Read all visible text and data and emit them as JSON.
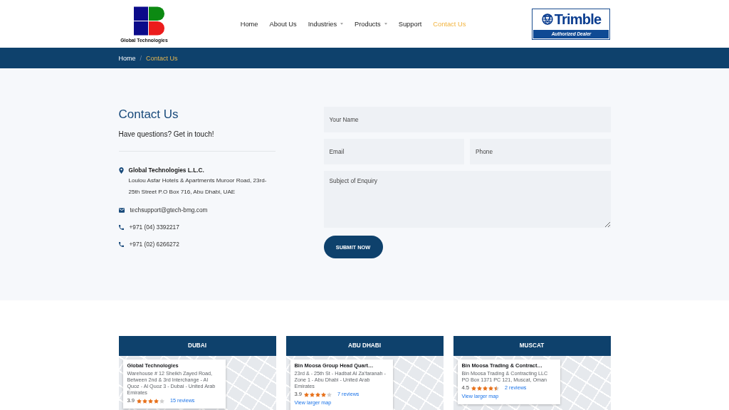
{
  "header": {
    "logo": {
      "caption": "Global Technologies"
    },
    "nav": [
      {
        "label": "Home",
        "selected": false,
        "has_dropdown": false
      },
      {
        "label": "About Us",
        "selected": false,
        "has_dropdown": false
      },
      {
        "label": "Industries",
        "selected": false,
        "has_dropdown": true
      },
      {
        "label": "Products",
        "selected": false,
        "has_dropdown": true
      },
      {
        "label": "Support",
        "selected": false,
        "has_dropdown": false
      },
      {
        "label": "Contact Us",
        "selected": true,
        "has_dropdown": false
      }
    ],
    "partner_badge": {
      "brand": "Trimble",
      "tagline": "Authorized Dealer"
    }
  },
  "breadcrumb": {
    "separator": "/",
    "items": [
      {
        "label": "Home",
        "current": false
      },
      {
        "label": "Contact Us",
        "current": true
      }
    ]
  },
  "contact": {
    "title": "Contact Us",
    "subtitle": "Have questions? Get in touch!",
    "details": [
      {
        "kind": "address",
        "name": "Global Technologies L.L.C.",
        "text": "Loulou Asfar Hotels & Apartments Muroor Road, 23rd-25th Street P.O Box 716, Abu Dhabi, UAE"
      },
      {
        "kind": "email",
        "text": "techsupport@gtech-bmg.com"
      },
      {
        "kind": "phone",
        "text": "+971 (04) 3392217"
      },
      {
        "kind": "phone",
        "text": "+971 (02) 6266272"
      }
    ]
  },
  "form": {
    "rows": [
      [
        {
          "kind": "input",
          "placeholder": "Your Name"
        }
      ],
      [
        {
          "kind": "input",
          "placeholder": "Email"
        },
        {
          "kind": "input",
          "placeholder": "Phone"
        }
      ],
      [
        {
          "kind": "textarea",
          "placeholder": "Subject of Enquiry"
        }
      ]
    ],
    "submit": "SUBMIT NOW"
  },
  "locations": [
    {
      "city": "DUBAI",
      "info": {
        "title": "Global Technologies",
        "address": "Warehouse # 12 Sheikh Zayed Road, Between 2nd & 3rd Interchange - Al Quoz - Al Quoz 3 - Dubai - United Arab Emirates",
        "rating": "3.9",
        "stars": 4,
        "reviews": "15 reviews"
      }
    },
    {
      "city": "ABU DHABI",
      "info": {
        "title": "Bin Moosa Group Head Quart…",
        "address": "23rd & - 25th St - Hadbat Al Za'faranah - Zone 1 - Abu Dhabi - United Arab Emirates",
        "rating": "3.9",
        "stars": 4,
        "reviews": "7 reviews",
        "link": "View larger map"
      }
    },
    {
      "city": "MUSCAT",
      "info": {
        "title": "Bin Moosa Trading & Contract…",
        "address": "Bin Moosa Trading & Contracting LLC PO Box 1371 PC 121, Muscat, Oman",
        "rating": "4.5",
        "stars": 4.5,
        "reviews": "2 reviews",
        "link": "View larger map"
      }
    }
  ]
}
